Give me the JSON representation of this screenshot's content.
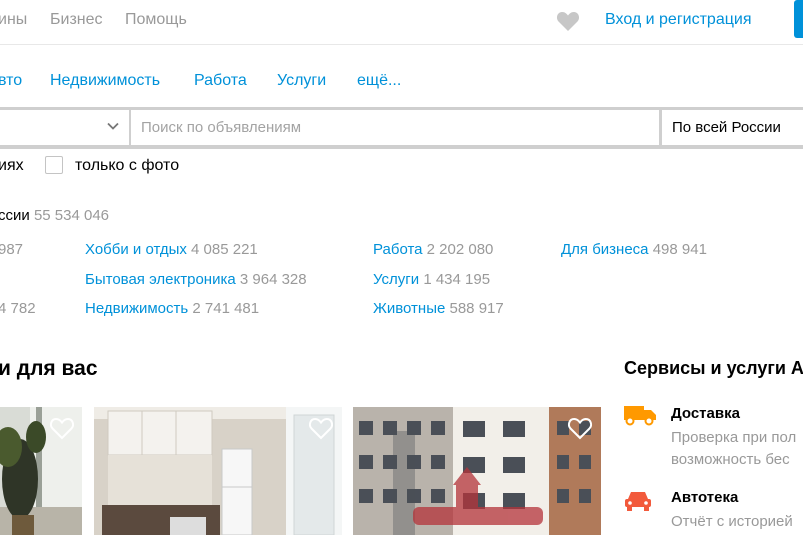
{
  "topbar": {
    "links": [
      "ины",
      "Бизнес",
      "Помощь"
    ],
    "login": "Вход и регистрация"
  },
  "nav": {
    "items": [
      "вто",
      "Недвижимость",
      "Работа",
      "Услуги",
      "ещё..."
    ]
  },
  "search": {
    "placeholder": "Поиск по объявлениям",
    "region": "По всей России"
  },
  "filters": {
    "partial_label": "иях",
    "photo_label": "только с фото"
  },
  "stats": {
    "total_label": "ссии",
    "total_count": "55 534 046",
    "col0": [
      "987",
      "4 782"
    ],
    "col1": [
      {
        "label": "Хобби и отдых",
        "count": "4 085 221"
      },
      {
        "label": "Бытовая электроника",
        "count": "3 964 328"
      },
      {
        "label": "Недвижимость",
        "count": "2 741 481"
      }
    ],
    "col2": [
      {
        "label": "Работа",
        "count": "2 202 080"
      },
      {
        "label": "Услуги",
        "count": "1 434 195"
      },
      {
        "label": "Животные",
        "count": "588 917"
      }
    ],
    "col3": [
      {
        "label": "Для бизнеса",
        "count": "498 941"
      }
    ]
  },
  "recommendations": {
    "title": "и для вас"
  },
  "services": {
    "title": "Сервисы и услуги А",
    "items": [
      {
        "title": "Доставка",
        "desc1": "Проверка при пол",
        "desc2": "возможность бес",
        "icon": "truck-icon",
        "color": "#ff9900"
      },
      {
        "title": "Автотека",
        "desc1": "Отчёт с историей",
        "icon": "car-icon",
        "color": "#f25a3c"
      }
    ]
  },
  "colors": {
    "link": "#0091d9",
    "muted": "#999999",
    "search_border": "#cfcfcf"
  }
}
